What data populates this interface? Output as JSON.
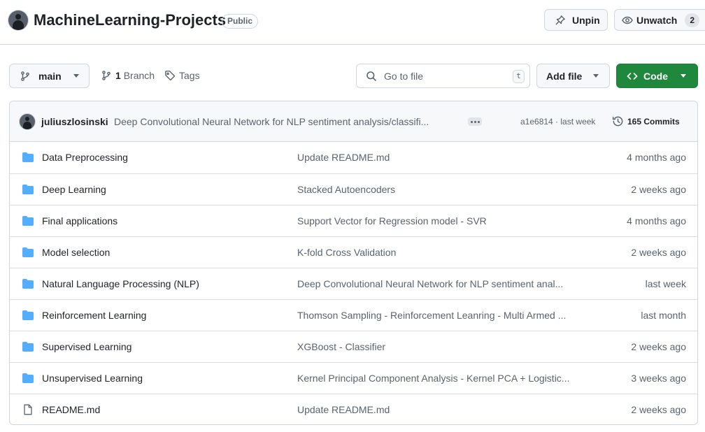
{
  "repo": {
    "name": "MachineLearning-Projects",
    "visibility": "Public",
    "unpin_label": "Unpin",
    "unwatch_label": "Unwatch",
    "watch_count": "2"
  },
  "toolbar": {
    "branch": "main",
    "branch_count": "1",
    "branch_word": "Branch",
    "tags_label": "Tags",
    "search_placeholder": "Go to file",
    "search_shortcut": "t",
    "add_file_label": "Add file",
    "code_label": "Code"
  },
  "commit": {
    "author": "juliuszlosinski",
    "message": "Deep Convolutional Neural Network for NLP sentiment analysis/classifi...",
    "sha": "a1e6814",
    "when": "last week",
    "commits_label": "165 Commits"
  },
  "files": [
    {
      "icon": "folder-icon",
      "name": "Data Preprocessing",
      "message": "Update README.md",
      "age": "4 months ago"
    },
    {
      "icon": "folder-icon",
      "name": "Deep Learning",
      "message": "Stacked Autoencoders",
      "age": "2 weeks ago"
    },
    {
      "icon": "folder-icon",
      "name": "Final applications",
      "message": "Support Vector for Regression model - SVR",
      "age": "4 months ago"
    },
    {
      "icon": "folder-icon",
      "name": "Model selection",
      "message": "K-fold Cross Validation",
      "age": "2 weeks ago"
    },
    {
      "icon": "folder-icon",
      "name": "Natural Language Processing (NLP)",
      "message": "Deep Convolutional Neural Network for NLP sentiment anal...",
      "age": "last week"
    },
    {
      "icon": "folder-icon",
      "name": "Reinforcement Learning",
      "message": "Thomson Sampling - Reinforcement Leanring - Multi Armed ...",
      "age": "last month"
    },
    {
      "icon": "folder-icon",
      "name": "Supervised Learning",
      "message": "XGBoost - Classifier",
      "age": "2 weeks ago"
    },
    {
      "icon": "folder-icon",
      "name": "Unsupervised Learning",
      "message": "Kernel Principal Component Analysis - Kernel PCA + Logistic...",
      "age": "3 weeks ago"
    },
    {
      "icon": "file-icon",
      "name": "README.md",
      "message": "Update README.md",
      "age": "2 weeks ago"
    }
  ],
  "colors": {
    "folder": "#54aeff",
    "code_button": "#1f883d",
    "muted_text": "#59636e",
    "border": "#d0d7de"
  }
}
